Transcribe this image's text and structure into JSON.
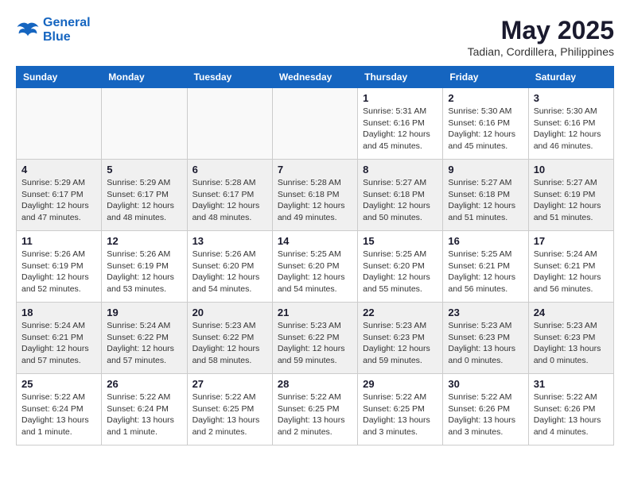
{
  "logo": {
    "line1": "General",
    "line2": "Blue"
  },
  "title": {
    "month_year": "May 2025",
    "location": "Tadian, Cordillera, Philippines"
  },
  "headers": [
    "Sunday",
    "Monday",
    "Tuesday",
    "Wednesday",
    "Thursday",
    "Friday",
    "Saturday"
  ],
  "weeks": [
    [
      {
        "day": "",
        "info": ""
      },
      {
        "day": "",
        "info": ""
      },
      {
        "day": "",
        "info": ""
      },
      {
        "day": "",
        "info": ""
      },
      {
        "day": "1",
        "info": "Sunrise: 5:31 AM\nSunset: 6:16 PM\nDaylight: 12 hours\nand 45 minutes."
      },
      {
        "day": "2",
        "info": "Sunrise: 5:30 AM\nSunset: 6:16 PM\nDaylight: 12 hours\nand 45 minutes."
      },
      {
        "day": "3",
        "info": "Sunrise: 5:30 AM\nSunset: 6:16 PM\nDaylight: 12 hours\nand 46 minutes."
      }
    ],
    [
      {
        "day": "4",
        "info": "Sunrise: 5:29 AM\nSunset: 6:17 PM\nDaylight: 12 hours\nand 47 minutes."
      },
      {
        "day": "5",
        "info": "Sunrise: 5:29 AM\nSunset: 6:17 PM\nDaylight: 12 hours\nand 48 minutes."
      },
      {
        "day": "6",
        "info": "Sunrise: 5:28 AM\nSunset: 6:17 PM\nDaylight: 12 hours\nand 48 minutes."
      },
      {
        "day": "7",
        "info": "Sunrise: 5:28 AM\nSunset: 6:18 PM\nDaylight: 12 hours\nand 49 minutes."
      },
      {
        "day": "8",
        "info": "Sunrise: 5:27 AM\nSunset: 6:18 PM\nDaylight: 12 hours\nand 50 minutes."
      },
      {
        "day": "9",
        "info": "Sunrise: 5:27 AM\nSunset: 6:18 PM\nDaylight: 12 hours\nand 51 minutes."
      },
      {
        "day": "10",
        "info": "Sunrise: 5:27 AM\nSunset: 6:19 PM\nDaylight: 12 hours\nand 51 minutes."
      }
    ],
    [
      {
        "day": "11",
        "info": "Sunrise: 5:26 AM\nSunset: 6:19 PM\nDaylight: 12 hours\nand 52 minutes."
      },
      {
        "day": "12",
        "info": "Sunrise: 5:26 AM\nSunset: 6:19 PM\nDaylight: 12 hours\nand 53 minutes."
      },
      {
        "day": "13",
        "info": "Sunrise: 5:26 AM\nSunset: 6:20 PM\nDaylight: 12 hours\nand 54 minutes."
      },
      {
        "day": "14",
        "info": "Sunrise: 5:25 AM\nSunset: 6:20 PM\nDaylight: 12 hours\nand 54 minutes."
      },
      {
        "day": "15",
        "info": "Sunrise: 5:25 AM\nSunset: 6:20 PM\nDaylight: 12 hours\nand 55 minutes."
      },
      {
        "day": "16",
        "info": "Sunrise: 5:25 AM\nSunset: 6:21 PM\nDaylight: 12 hours\nand 56 minutes."
      },
      {
        "day": "17",
        "info": "Sunrise: 5:24 AM\nSunset: 6:21 PM\nDaylight: 12 hours\nand 56 minutes."
      }
    ],
    [
      {
        "day": "18",
        "info": "Sunrise: 5:24 AM\nSunset: 6:21 PM\nDaylight: 12 hours\nand 57 minutes."
      },
      {
        "day": "19",
        "info": "Sunrise: 5:24 AM\nSunset: 6:22 PM\nDaylight: 12 hours\nand 57 minutes."
      },
      {
        "day": "20",
        "info": "Sunrise: 5:23 AM\nSunset: 6:22 PM\nDaylight: 12 hours\nand 58 minutes."
      },
      {
        "day": "21",
        "info": "Sunrise: 5:23 AM\nSunset: 6:22 PM\nDaylight: 12 hours\nand 59 minutes."
      },
      {
        "day": "22",
        "info": "Sunrise: 5:23 AM\nSunset: 6:23 PM\nDaylight: 12 hours\nand 59 minutes."
      },
      {
        "day": "23",
        "info": "Sunrise: 5:23 AM\nSunset: 6:23 PM\nDaylight: 13 hours\nand 0 minutes."
      },
      {
        "day": "24",
        "info": "Sunrise: 5:23 AM\nSunset: 6:23 PM\nDaylight: 13 hours\nand 0 minutes."
      }
    ],
    [
      {
        "day": "25",
        "info": "Sunrise: 5:22 AM\nSunset: 6:24 PM\nDaylight: 13 hours\nand 1 minute."
      },
      {
        "day": "26",
        "info": "Sunrise: 5:22 AM\nSunset: 6:24 PM\nDaylight: 13 hours\nand 1 minute."
      },
      {
        "day": "27",
        "info": "Sunrise: 5:22 AM\nSunset: 6:25 PM\nDaylight: 13 hours\nand 2 minutes."
      },
      {
        "day": "28",
        "info": "Sunrise: 5:22 AM\nSunset: 6:25 PM\nDaylight: 13 hours\nand 2 minutes."
      },
      {
        "day": "29",
        "info": "Sunrise: 5:22 AM\nSunset: 6:25 PM\nDaylight: 13 hours\nand 3 minutes."
      },
      {
        "day": "30",
        "info": "Sunrise: 5:22 AM\nSunset: 6:26 PM\nDaylight: 13 hours\nand 3 minutes."
      },
      {
        "day": "31",
        "info": "Sunrise: 5:22 AM\nSunset: 6:26 PM\nDaylight: 13 hours\nand 4 minutes."
      }
    ]
  ]
}
